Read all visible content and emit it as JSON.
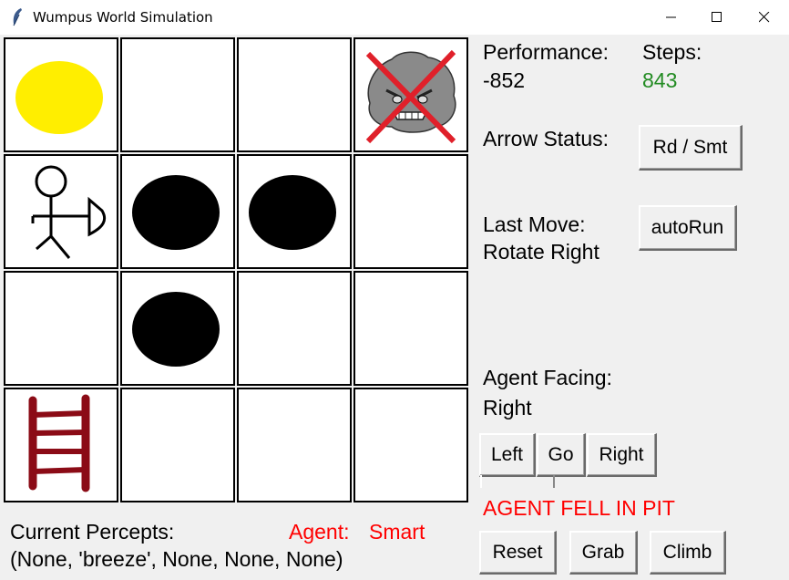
{
  "window": {
    "title": "Wumpus World Simulation",
    "app_icon": "feather-icon",
    "controls": [
      "minimize-icon",
      "maximize-icon",
      "close-icon"
    ]
  },
  "board": {
    "rows": 4,
    "cols": 4,
    "cells": [
      [
        "gold",
        "empty",
        "empty",
        "dead-wumpus"
      ],
      [
        "agent-facing-right",
        "pit",
        "pit",
        "empty"
      ],
      [
        "empty",
        "pit",
        "empty",
        "empty"
      ],
      [
        "ladder",
        "empty",
        "empty",
        "empty"
      ]
    ]
  },
  "colors": {
    "gold": "#ffee00",
    "pit": "#000000",
    "ladder": "#8b0b16",
    "cross": "#e0202a",
    "steps_value": "#228b22",
    "alert": "#ff0000"
  },
  "status": {
    "performance_label": "Performance:",
    "performance_value": "-852",
    "steps_label": "Steps:",
    "steps_value": "843",
    "arrow_label": "Arrow Status:",
    "last_move_label": "Last Move:",
    "last_move_value": "Rotate Right",
    "facing_label": "Agent Facing:",
    "facing_value": "Right",
    "alert": "AGENT FELL IN PIT"
  },
  "buttons": {
    "mode": "Rd / Smt",
    "autorun": "autoRun",
    "left": "Left",
    "go": "Go",
    "right": "Right",
    "reset": "Reset",
    "grab": "Grab",
    "climb": "Climb"
  },
  "percepts": {
    "label": "Current Percepts:",
    "value": "(None, 'breeze', None, None, None)",
    "agent_label": "Agent:",
    "agent_value": "Smart"
  }
}
